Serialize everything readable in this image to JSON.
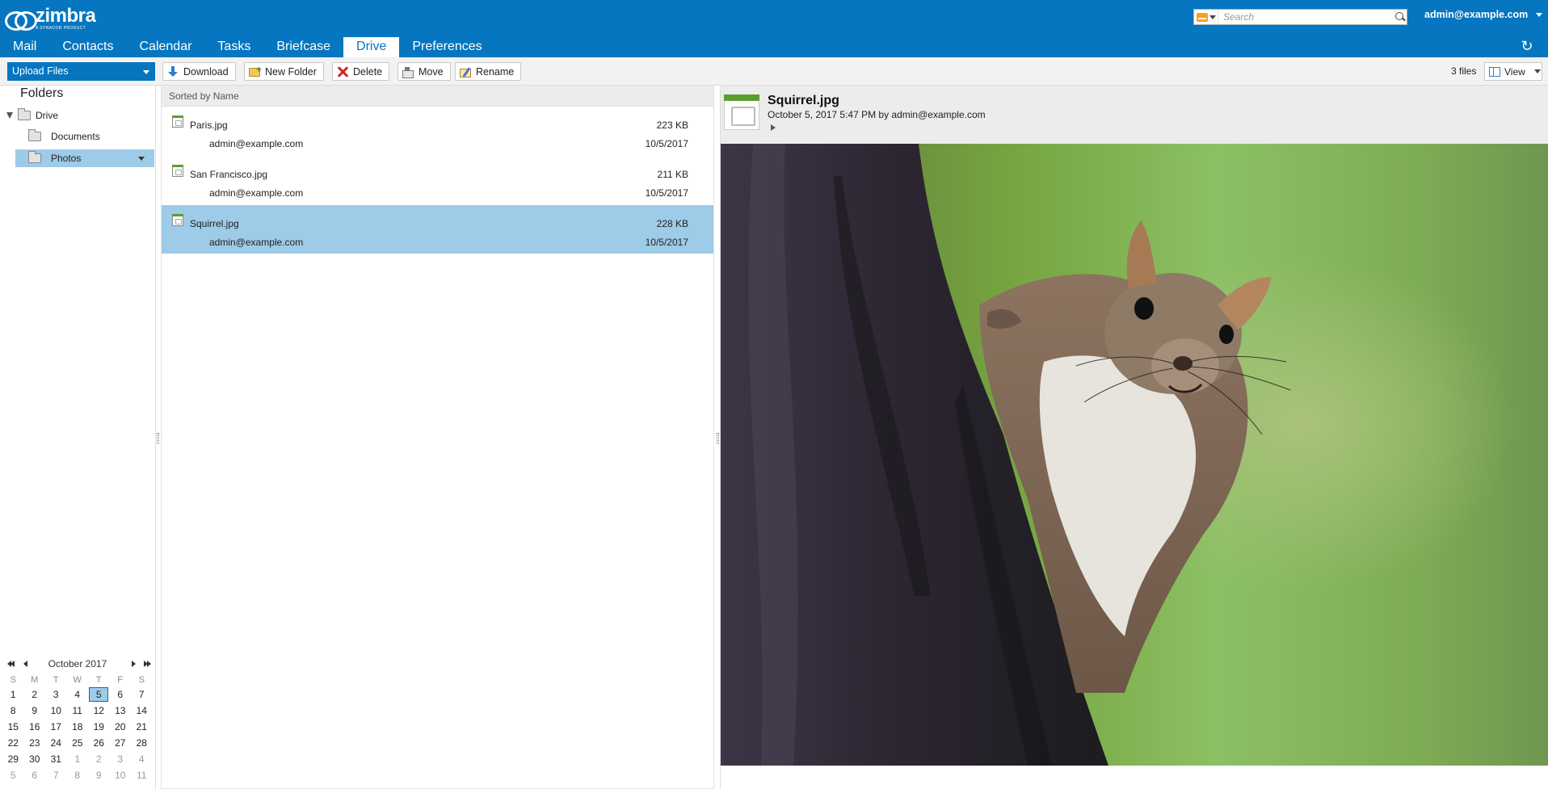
{
  "header": {
    "logo_word": "zimbra",
    "logo_sub": "A SYNACOR PRODUCT",
    "search_placeholder": "Search",
    "user": "admin@example.com"
  },
  "tabs": [
    {
      "label": "Mail"
    },
    {
      "label": "Contacts"
    },
    {
      "label": "Calendar"
    },
    {
      "label": "Tasks"
    },
    {
      "label": "Briefcase"
    },
    {
      "label": "Drive",
      "active": true
    },
    {
      "label": "Preferences"
    }
  ],
  "toolbar": {
    "upload_label": "Upload Files",
    "download_label": "Download",
    "new_folder_label": "New Folder",
    "delete_label": "Delete",
    "move_label": "Move",
    "rename_label": "Rename",
    "files_count": "3 files",
    "view_label": "View"
  },
  "folders": {
    "title": "Folders",
    "root": "Drive",
    "items": [
      {
        "label": "Documents"
      },
      {
        "label": "Photos",
        "selected": true
      }
    ]
  },
  "calendar": {
    "month_label": "October 2017",
    "dow": [
      "S",
      "M",
      "T",
      "W",
      "T",
      "F",
      "S"
    ],
    "today": "5",
    "days": [
      [
        "1",
        "2",
        "3",
        "4",
        "5",
        "6",
        "7"
      ],
      [
        "8",
        "9",
        "10",
        "11",
        "12",
        "13",
        "14"
      ],
      [
        "15",
        "16",
        "17",
        "18",
        "19",
        "20",
        "21"
      ],
      [
        "22",
        "23",
        "24",
        "25",
        "26",
        "27",
        "28"
      ],
      [
        "29",
        "30",
        "31",
        "1",
        "2",
        "3",
        "4"
      ],
      [
        "5",
        "6",
        "7",
        "8",
        "9",
        "10",
        "11"
      ]
    ]
  },
  "list": {
    "sort_label": "Sorted by Name",
    "files": [
      {
        "name": "Paris.jpg",
        "size": "223 KB",
        "owner": "admin@example.com",
        "date": "10/5/2017"
      },
      {
        "name": "San Francisco.jpg",
        "size": "211 KB",
        "owner": "admin@example.com",
        "date": "10/5/2017"
      },
      {
        "name": "Squirrel.jpg",
        "size": "228 KB",
        "owner": "admin@example.com",
        "date": "10/5/2017",
        "selected": true
      }
    ]
  },
  "preview": {
    "title": "Squirrel.jpg",
    "meta": "October 5, 2017 5:47 PM by admin@example.com"
  },
  "colors": {
    "brand": "#0576bf",
    "selection": "#9dcbe8"
  }
}
